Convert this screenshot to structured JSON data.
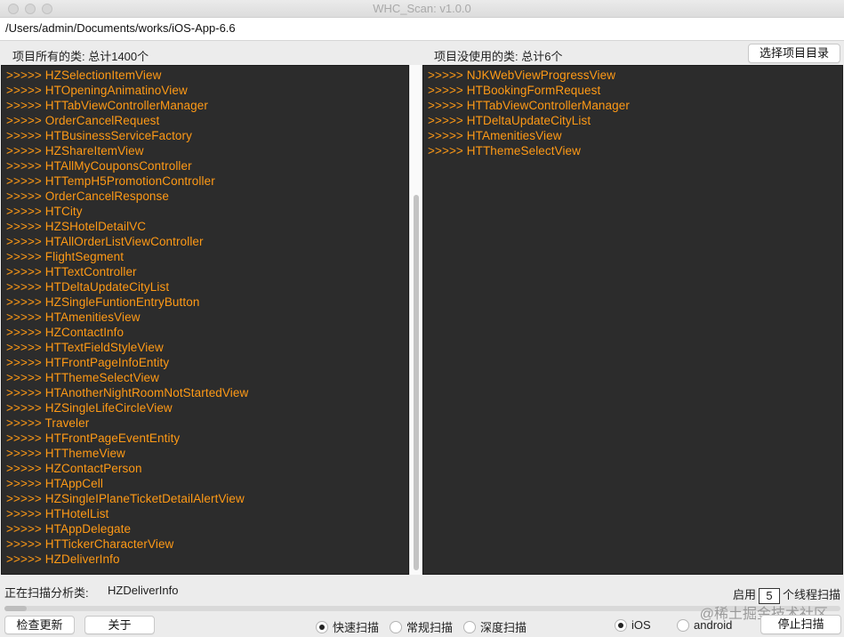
{
  "window": {
    "title": "WHC_Scan: v1.0.0"
  },
  "path": {
    "value": "/Users/admin/Documents/works/iOS-App-6.6"
  },
  "header": {
    "all_classes_label": "项目所有的类: 总计1400个",
    "unused_classes_label": "项目没使用的类: 总计6个",
    "choose_dir_button": "选择项目目录"
  },
  "left_list": [
    ">>>>> HZSelectionItemView",
    ">>>>> HTOpeningAnimatinoView",
    ">>>>> HTTabViewControllerManager",
    ">>>>> OrderCancelRequest",
    ">>>>> HTBusinessServiceFactory",
    ">>>>> HZShareItemView",
    ">>>>> HTAllMyCouponsController",
    ">>>>> HTTempH5PromotionController",
    ">>>>> OrderCancelResponse",
    ">>>>> HTCity",
    ">>>>> HZSHotelDetailVC",
    ">>>>> HTAllOrderListViewController",
    ">>>>> FlightSegment",
    ">>>>> HTTextController",
    ">>>>> HTDeltaUpdateCityList",
    ">>>>> HZSingleFuntionEntryButton",
    ">>>>> HTAmenitiesView",
    ">>>>> HZContactInfo",
    ">>>>> HTTextFieldStyleView",
    ">>>>> HTFrontPageInfoEntity",
    ">>>>> HTThemeSelectView",
    ">>>>> HTAnotherNightRoomNotStartedView",
    ">>>>> HZSingleLifeCircleView",
    ">>>>> Traveler",
    ">>>>> HTFrontPageEventEntity",
    ">>>>> HTThemeView",
    ">>>>> HZContactPerson",
    ">>>>> HTAppCell",
    ">>>>> HZSingleIPlaneTicketDetailAlertView",
    ">>>>> HTHotelList",
    ">>>>> HTAppDelegate",
    ">>>>> HTTickerCharacterView",
    ">>>>> HZDeliverInfo"
  ],
  "right_list": [
    ">>>>> NJKWebViewProgressView",
    ">>>>> HTBookingFormRequest",
    ">>>>> HTTabViewControllerManager",
    ">>>>> HTDeltaUpdateCityList",
    ">>>>> HTAmenitiesView",
    ">>>>> HTThemeSelectView"
  ],
  "status": {
    "scanning_label": "正在扫描分析类:",
    "scanning_value": "HZDeliverInfo",
    "threads_prefix": "启用",
    "threads_value": "5",
    "threads_suffix": "个线程扫描",
    "progress_fraction": 0.027
  },
  "bottom": {
    "check_update": "检查更新",
    "about": "关于",
    "scan_modes": [
      {
        "label": "快速扫描",
        "checked": true
      },
      {
        "label": "常规扫描",
        "checked": false
      },
      {
        "label": "深度扫描",
        "checked": false
      }
    ],
    "platforms": [
      {
        "label": "iOS",
        "checked": true
      },
      {
        "label": "android",
        "checked": false
      }
    ],
    "stop_scan": "停止扫描"
  },
  "watermark": "@稀土掘金技术社区",
  "colors": {
    "list_text": "#ff9a16",
    "pane_bg": "#2c2c2c"
  }
}
